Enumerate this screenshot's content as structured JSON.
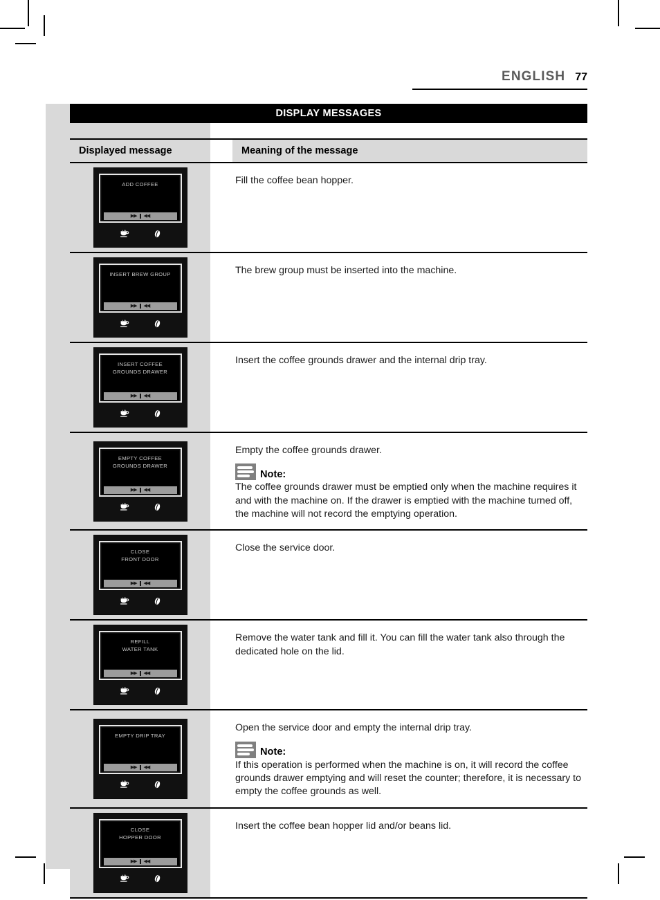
{
  "header": {
    "language": "ENGLISH",
    "page_number": "77"
  },
  "table": {
    "title": "DISPLAY MESSAGES",
    "columns": {
      "left": "Displayed message",
      "right": "Meaning of the message"
    },
    "note_label": "Note:",
    "display_icons": {
      "cup": "coffee-cup-icon",
      "bean": "coffee-bean-icon"
    },
    "rows": [
      {
        "display_lines": [
          "ADD COFFEE"
        ],
        "meaning": "Fill the coffee bean hopper.",
        "note": null
      },
      {
        "display_lines": [
          "INSERT BREW GROUP"
        ],
        "meaning": "The brew group must be inserted into the machine.",
        "note": null
      },
      {
        "display_lines": [
          "INSERT COFFEE",
          "GROUNDS DRAWER"
        ],
        "meaning": "Insert the coffee grounds drawer and the internal drip tray.",
        "note": null
      },
      {
        "display_lines": [
          "EMPTY COFFEE",
          "GROUNDS DRAWER"
        ],
        "meaning": "Empty the coffee grounds drawer.",
        "note": "The coffee grounds drawer must be emptied only when the machine requires it and with the machine on. If the drawer is emptied with the machine turned off, the machine will not record the emptying operation."
      },
      {
        "display_lines": [
          "CLOSE",
          "FRONT DOOR"
        ],
        "meaning": "Close the service door.",
        "note": null
      },
      {
        "display_lines": [
          "REFILL",
          "WATER TANK"
        ],
        "meaning": "Remove the water tank and fill it. You can fill the water tank also through the dedicated hole on the lid.",
        "note": null
      },
      {
        "display_lines": [
          "EMPTY DRIP TRAY"
        ],
        "meaning": "Open the service door and empty the internal drip tray.",
        "note": "If this operation is performed when the machine is on, it will record the coffee grounds drawer emptying and will reset the counter; therefore, it is necessary to empty the coffee grounds as well."
      },
      {
        "display_lines": [
          "CLOSE",
          "HOPPER DOOR"
        ],
        "meaning": "Insert the coffee bean hopper lid and/or beans lid.",
        "note": null
      }
    ]
  },
  "colors": {
    "accent_grey": "#d9d9d9",
    "title_bar": "#000000",
    "note_icon": "#808080"
  }
}
